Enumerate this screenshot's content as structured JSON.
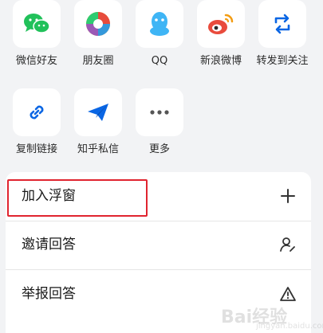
{
  "share_targets": [
    {
      "label": "微信好友",
      "icon": "wechat-icon",
      "color": "#21c15a"
    },
    {
      "label": "朋友圈",
      "icon": "moments-icon",
      "color": "#f39c12"
    },
    {
      "label": "QQ",
      "icon": "qq-icon",
      "color": "#3fb5f5"
    },
    {
      "label": "新浪微博",
      "icon": "weibo-icon",
      "color": "#e94b3c"
    },
    {
      "label": "转发到关注",
      "icon": "repost-icon",
      "color": "#0a66e4"
    },
    {
      "label": "复制链接",
      "icon": "link-icon",
      "color": "#0a66e4"
    },
    {
      "label": "知乎私信",
      "icon": "paper-plane-icon",
      "color": "#0a66e4"
    },
    {
      "label": "更多",
      "icon": "more-icon",
      "color": "#555555"
    }
  ],
  "actions": [
    {
      "label": "加入浮窗",
      "icon": "plus-icon"
    },
    {
      "label": "邀请回答",
      "icon": "invite-user-icon"
    },
    {
      "label": "举报回答",
      "icon": "warning-icon"
    }
  ],
  "highlight_color": "#e0242f",
  "watermark": {
    "main": "Bai经验",
    "sub": "jingyan.baidu.com"
  }
}
